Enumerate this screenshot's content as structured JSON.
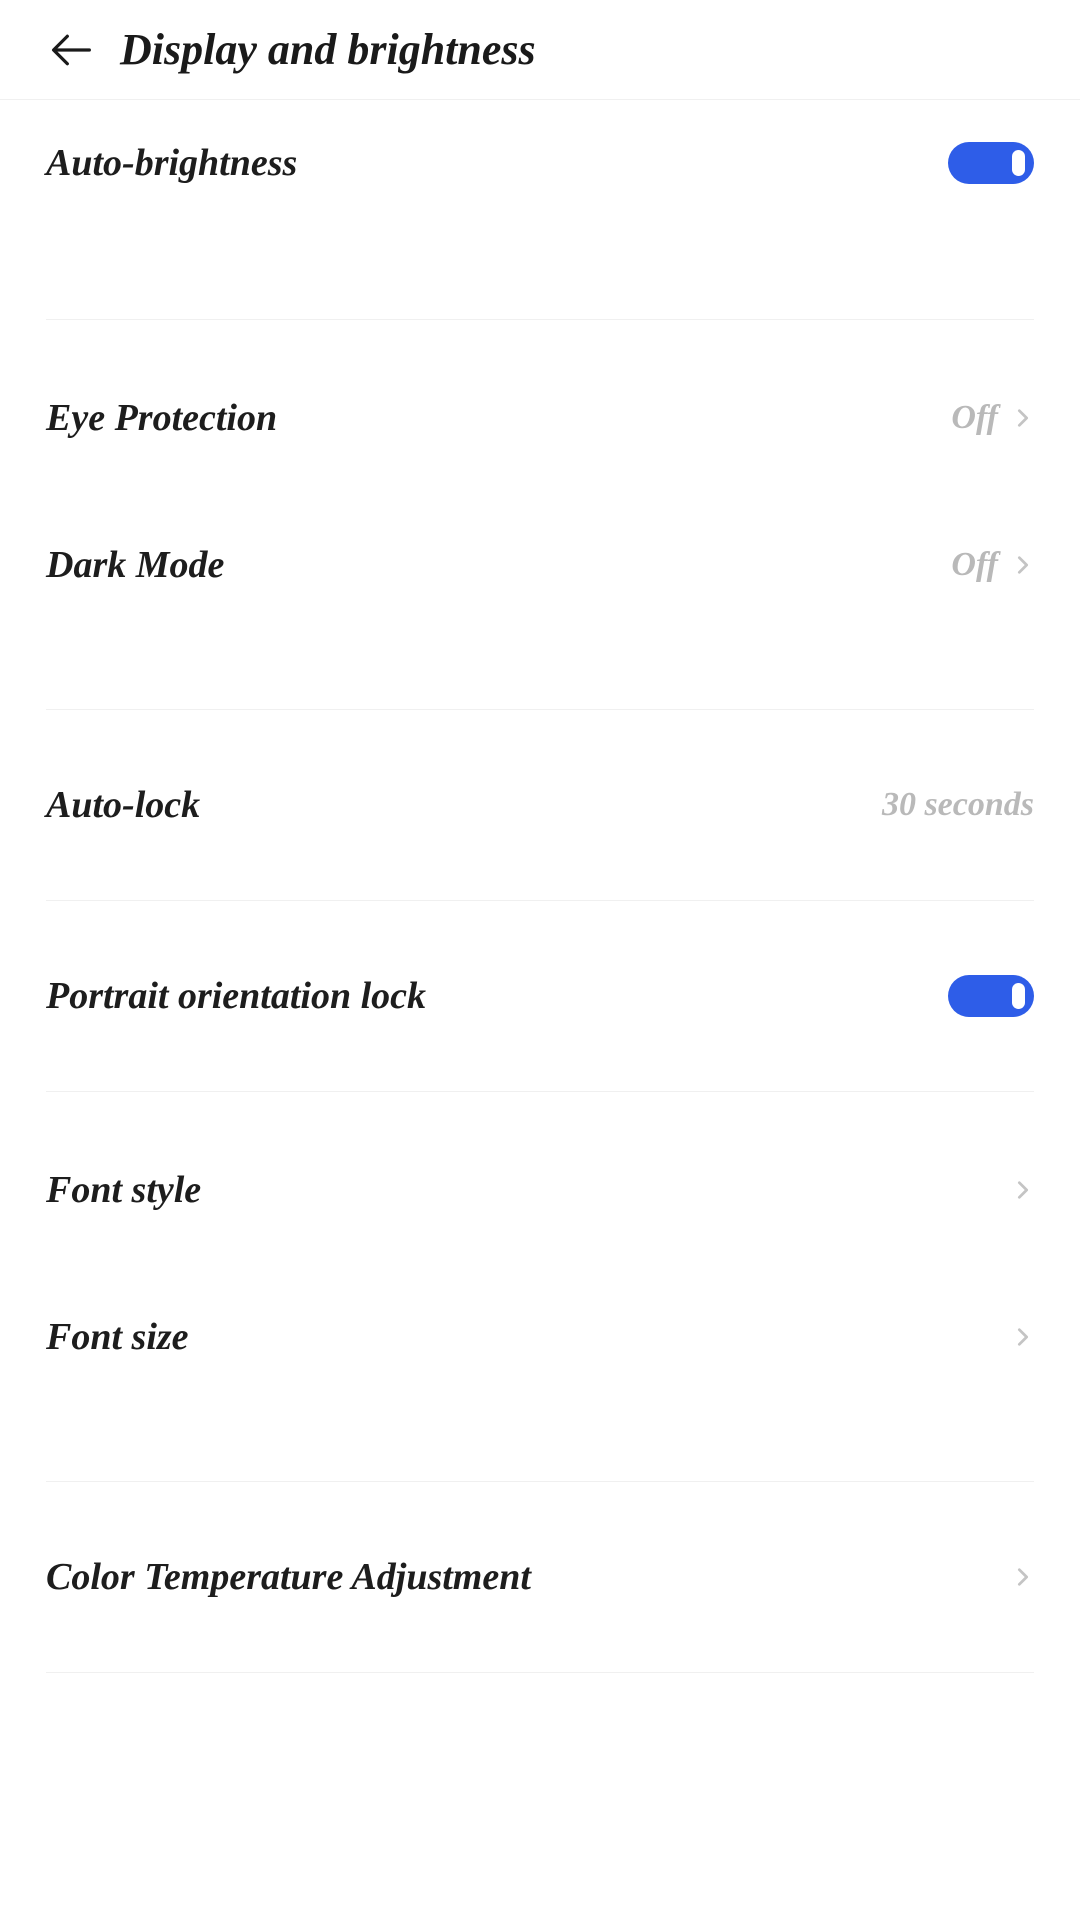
{
  "header": {
    "title": "Display and brightness"
  },
  "rows": {
    "auto_brightness": {
      "label": "Auto-brightness"
    },
    "eye_protection": {
      "label": "Eye Protection",
      "value": "Off"
    },
    "dark_mode": {
      "label": "Dark Mode",
      "value": "Off"
    },
    "auto_lock": {
      "label": "Auto-lock",
      "value": "30 seconds"
    },
    "portrait_lock": {
      "label": "Portrait orientation lock"
    },
    "font_style": {
      "label": "Font style"
    },
    "font_size": {
      "label": "Font size"
    },
    "color_temp": {
      "label": "Color Temperature Adjustment"
    }
  },
  "colors": {
    "accent": "#2e5de8",
    "highlight": "#f58a83"
  }
}
